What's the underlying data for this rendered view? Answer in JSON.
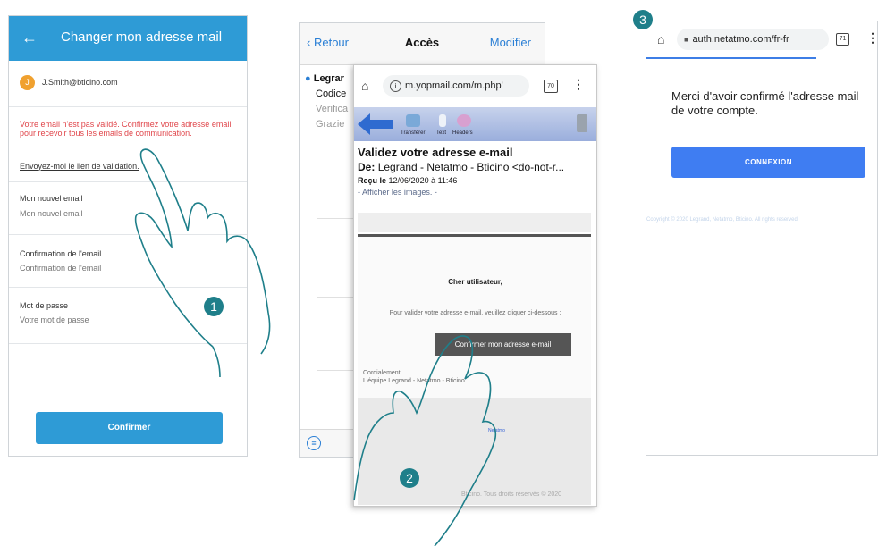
{
  "panel1": {
    "header_title": "Changer mon adresse mail",
    "account_initial": "J",
    "account_email": "J.Smith@bticino.com",
    "warning": "Votre email n'est pas validé. Confirmez votre adresse email pour recevoir tous les emails de communication.",
    "send_link": "Envoyez-moi le lien de validation.",
    "new_email_label": "Mon nouvel email",
    "new_email_placeholder": "Mon nouvel email",
    "confirm_email_label": "Confirmation de l'email",
    "confirm_email_placeholder": "Confirmation de l'email",
    "password_label": "Mot de passe",
    "password_placeholder": "Votre mot de passe",
    "confirm_button": "Confirmer"
  },
  "panel2_back": {
    "back_label": "Retour",
    "title": "Accès",
    "edit_label": "Modifier",
    "line1": "Legrar",
    "line2": "Codice",
    "line3": "Verifica",
    "line4": "Grazie"
  },
  "panel2_front": {
    "url": "m.yopmail.com/m.php'",
    "tab_count": "70",
    "toolbar_labels": [
      "Transférer",
      "Text",
      "Headers"
    ],
    "subject": "Validez votre adresse e-mail",
    "from_label": "De:",
    "from_value": "Legrand - Netatmo - Bticino <do-not-r...",
    "received_label": "Reçu le",
    "received_value": "12/06/2020 à 11:46",
    "show_images": "- Afficher les images. -",
    "greeting": "Cher utilisateur,",
    "instruction": "Pour valider votre adresse e-mail, veuillez cliquer ci-dessous :",
    "cta": "Confirmer mon adresse e-mail",
    "closing": "Cordialement,",
    "team": "L'équipe Legrand - Netatmo - Bticino",
    "footer_link": "Netatmo",
    "footer_copy": "Bticino. Tous droits réservés © 2020"
  },
  "panel3": {
    "url": "auth.netatmo.com/fr-fr",
    "tab_count": "71",
    "message": "Merci d'avoir confirmé l'adresse mail de votre compte.",
    "button": "CONNEXION",
    "copyright": "Copyright © 2020 Legrand, Netatmo, Bticino. All rights reserved"
  },
  "steps": [
    "1",
    "2",
    "3"
  ],
  "colors": {
    "app_blue": "#2e9bd6",
    "warning_red": "#e0454a",
    "ios_blue": "#2a7fd5",
    "netatmo_blue": "#3f7df2",
    "badge_teal": "#1f7f8a"
  }
}
